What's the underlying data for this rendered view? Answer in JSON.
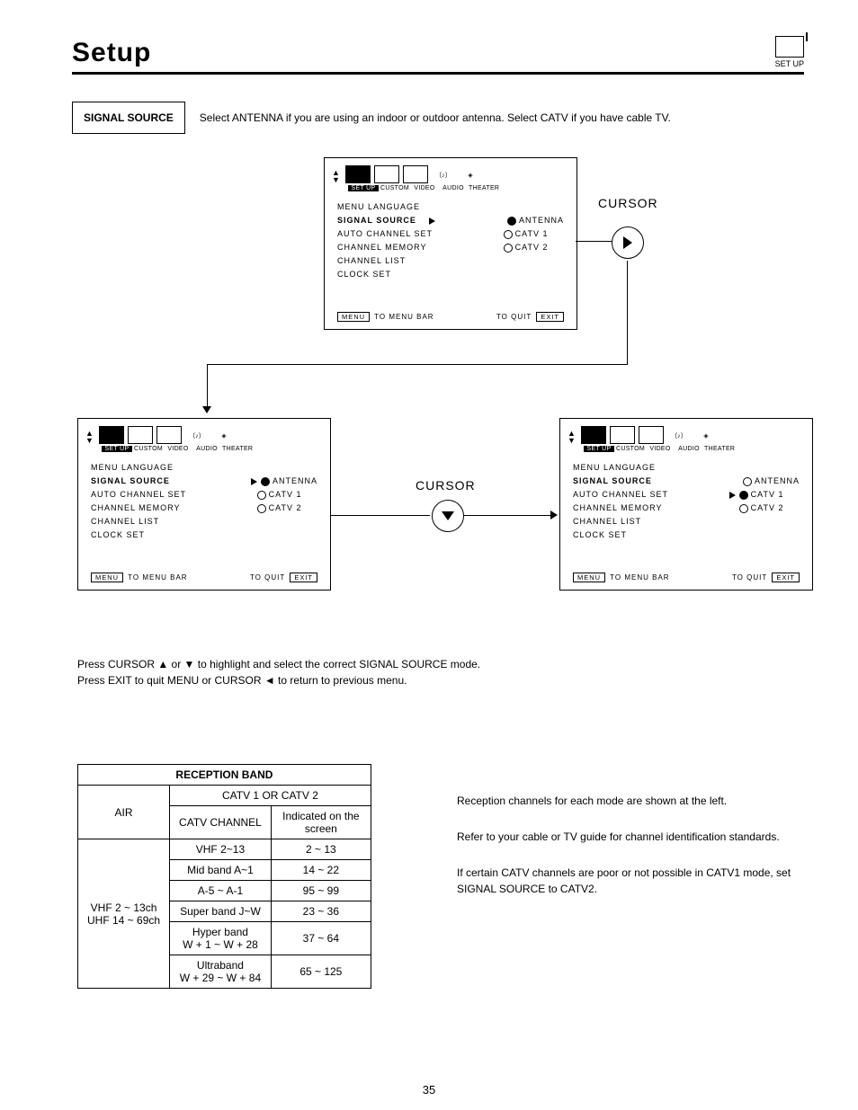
{
  "header": {
    "title": "Setup",
    "icon_label": "SET UP"
  },
  "signal": {
    "box": "SIGNAL SOURCE",
    "desc": "Select ANTENNA if you are using an indoor or outdoor antenna.  Select CATV if you have cable TV."
  },
  "osd_tabs": {
    "setup": "SET UP",
    "custom": "CUSTOM",
    "video": "VIDEO",
    "audio": "AUDIO",
    "theater": "THEATER"
  },
  "menu": {
    "lang": "MENU LANGUAGE",
    "signal": "SIGNAL SOURCE",
    "autoch": "AUTO CHANNEL SET",
    "chmem": "CHANNEL MEMORY",
    "chlist": "CHANNEL LIST",
    "clock": "CLOCK SET"
  },
  "opts": {
    "antenna": "ANTENNA",
    "catv1": "CATV 1",
    "catv2": "CATV 2"
  },
  "footer": {
    "menu_btn": "MENU",
    "to_menu": "TO MENU BAR",
    "to_quit": "TO QUIT",
    "exit_btn": "EXIT"
  },
  "cursor": {
    "label": "CURSOR"
  },
  "instructions": {
    "l1": "Press CURSOR ▲ or ▼ to highlight and select the correct SIGNAL SOURCE mode.",
    "l2": "Press EXIT to quit MENU or CURSOR ◄ to return to previous menu."
  },
  "table": {
    "title": "RECEPTION BAND",
    "catv_hdr": "CATV 1 OR CATV 2",
    "air": "AIR",
    "catv_col": "CATV CHANNEL",
    "ind_col": "Indicated on the screen",
    "air_rows": [
      "VHF 2 ~ 13ch",
      "UHF 14 ~ 69ch"
    ],
    "rows": [
      {
        "c": "VHF 2~13",
        "i": "2 ~ 13"
      },
      {
        "c": "Mid band A~1",
        "i": "14 ~ 22"
      },
      {
        "c": "A-5 ~ A-1",
        "i": "95 ~ 99"
      },
      {
        "c": "Super band J~W",
        "i": "23 ~ 36"
      },
      {
        "c": "Hyper band\nW + 1 ~ W + 28",
        "i": "37 ~ 64"
      },
      {
        "c": "Ultraband\nW + 29 ~ W + 84",
        "i": "65 ~ 125"
      }
    ]
  },
  "right_text": {
    "p1": "Reception channels for each mode are shown at the left.",
    "p2": "Refer to your cable or TV guide for channel identification standards.",
    "p3": "If certain CATV channels are poor or not possible in CATV1 mode, set SIGNAL SOURCE to CATV2."
  },
  "page_number": "35"
}
